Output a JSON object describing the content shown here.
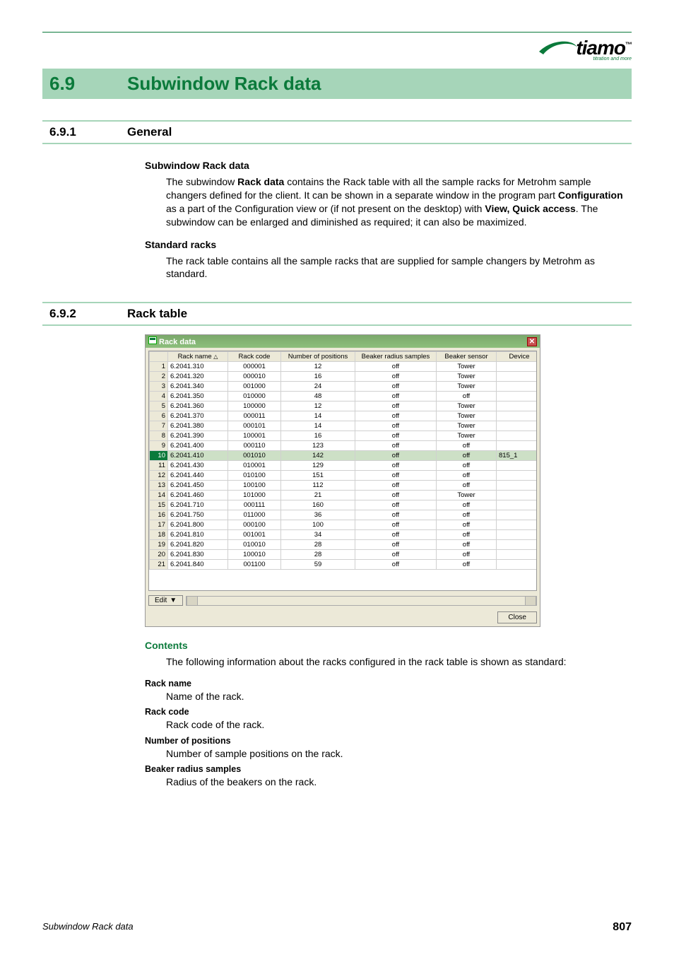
{
  "logo": {
    "name": "tiamo",
    "tagline": "titration and more",
    "tm": "™"
  },
  "section": {
    "num": "6.9",
    "title": "Subwindow Rack data"
  },
  "sub1": {
    "num": "6.9.1",
    "title": "General"
  },
  "sub2": {
    "num": "6.9.2",
    "title": "Rack table"
  },
  "h_subwindow": "Subwindow Rack data",
  "p_subwindow_a": "The subwindow ",
  "p_subwindow_b": "Rack data",
  "p_subwindow_c": " contains the Rack table with all the sample racks for Metrohm sample changers defined for the client. It can be shown in a separate window in the program part ",
  "p_subwindow_d": "Configuration",
  "p_subwindow_e": " as a part of the Configuration view or (if not present on the desktop) with ",
  "p_subwindow_f": "View, Quick access",
  "p_subwindow_g": ". The subwindow can be enlarged and diminished as required; it can also be maximized.",
  "h_standard": "Standard racks",
  "p_standard": "The rack table contains all the sample racks that are supplied for sample changers by Metrohm as standard.",
  "screenshot": {
    "title": "Rack data",
    "columns": [
      "Rack name",
      "Rack code",
      "Number of positions",
      "Beaker radius samples",
      "Beaker sensor",
      "Device"
    ],
    "sort_indicator": "△",
    "selected_row": 10,
    "rows": [
      {
        "n": 1,
        "name": "6.2041.310",
        "code": "000001",
        "pos": "12",
        "brs": "off",
        "bs": "Tower",
        "dev": ""
      },
      {
        "n": 2,
        "name": "6.2041.320",
        "code": "000010",
        "pos": "16",
        "brs": "off",
        "bs": "Tower",
        "dev": ""
      },
      {
        "n": 3,
        "name": "6.2041.340",
        "code": "001000",
        "pos": "24",
        "brs": "off",
        "bs": "Tower",
        "dev": ""
      },
      {
        "n": 4,
        "name": "6.2041.350",
        "code": "010000",
        "pos": "48",
        "brs": "off",
        "bs": "off",
        "dev": ""
      },
      {
        "n": 5,
        "name": "6.2041.360",
        "code": "100000",
        "pos": "12",
        "brs": "off",
        "bs": "Tower",
        "dev": ""
      },
      {
        "n": 6,
        "name": "6.2041.370",
        "code": "000011",
        "pos": "14",
        "brs": "off",
        "bs": "Tower",
        "dev": ""
      },
      {
        "n": 7,
        "name": "6.2041.380",
        "code": "000101",
        "pos": "14",
        "brs": "off",
        "bs": "Tower",
        "dev": ""
      },
      {
        "n": 8,
        "name": "6.2041.390",
        "code": "100001",
        "pos": "16",
        "brs": "off",
        "bs": "Tower",
        "dev": ""
      },
      {
        "n": 9,
        "name": "6.2041.400",
        "code": "000110",
        "pos": "123",
        "brs": "off",
        "bs": "off",
        "dev": ""
      },
      {
        "n": 10,
        "name": "6.2041.410",
        "code": "001010",
        "pos": "142",
        "brs": "off",
        "bs": "off",
        "dev": "815_1"
      },
      {
        "n": 11,
        "name": "6.2041.430",
        "code": "010001",
        "pos": "129",
        "brs": "off",
        "bs": "off",
        "dev": ""
      },
      {
        "n": 12,
        "name": "6.2041.440",
        "code": "010100",
        "pos": "151",
        "brs": "off",
        "bs": "off",
        "dev": ""
      },
      {
        "n": 13,
        "name": "6.2041.450",
        "code": "100100",
        "pos": "112",
        "brs": "off",
        "bs": "off",
        "dev": ""
      },
      {
        "n": 14,
        "name": "6.2041.460",
        "code": "101000",
        "pos": "21",
        "brs": "off",
        "bs": "Tower",
        "dev": ""
      },
      {
        "n": 15,
        "name": "6.2041.710",
        "code": "000111",
        "pos": "160",
        "brs": "off",
        "bs": "off",
        "dev": ""
      },
      {
        "n": 16,
        "name": "6.2041.750",
        "code": "011000",
        "pos": "36",
        "brs": "off",
        "bs": "off",
        "dev": ""
      },
      {
        "n": 17,
        "name": "6.2041.800",
        "code": "000100",
        "pos": "100",
        "brs": "off",
        "bs": "off",
        "dev": ""
      },
      {
        "n": 18,
        "name": "6.2041.810",
        "code": "001001",
        "pos": "34",
        "brs": "off",
        "bs": "off",
        "dev": ""
      },
      {
        "n": 19,
        "name": "6.2041.820",
        "code": "010010",
        "pos": "28",
        "brs": "off",
        "bs": "off",
        "dev": ""
      },
      {
        "n": 20,
        "name": "6.2041.830",
        "code": "100010",
        "pos": "28",
        "brs": "off",
        "bs": "off",
        "dev": ""
      },
      {
        "n": 21,
        "name": "6.2041.840",
        "code": "001100",
        "pos": "59",
        "brs": "off",
        "bs": "off",
        "dev": ""
      }
    ],
    "edit_label": "Edit",
    "close_label": "Close"
  },
  "h_contents": "Contents",
  "p_contents": "The following information about the racks configured in the rack table is shown as standard:",
  "defs": [
    {
      "term": "Rack name",
      "body": "Name of the rack."
    },
    {
      "term": "Rack code",
      "body": "Rack code of the rack."
    },
    {
      "term": "Number of positions",
      "body": "Number of sample positions on the rack."
    },
    {
      "term": "Beaker radius samples",
      "body": "Radius of the beakers on the rack."
    }
  ],
  "footer": {
    "left": "Subwindow Rack data",
    "right": "807"
  }
}
